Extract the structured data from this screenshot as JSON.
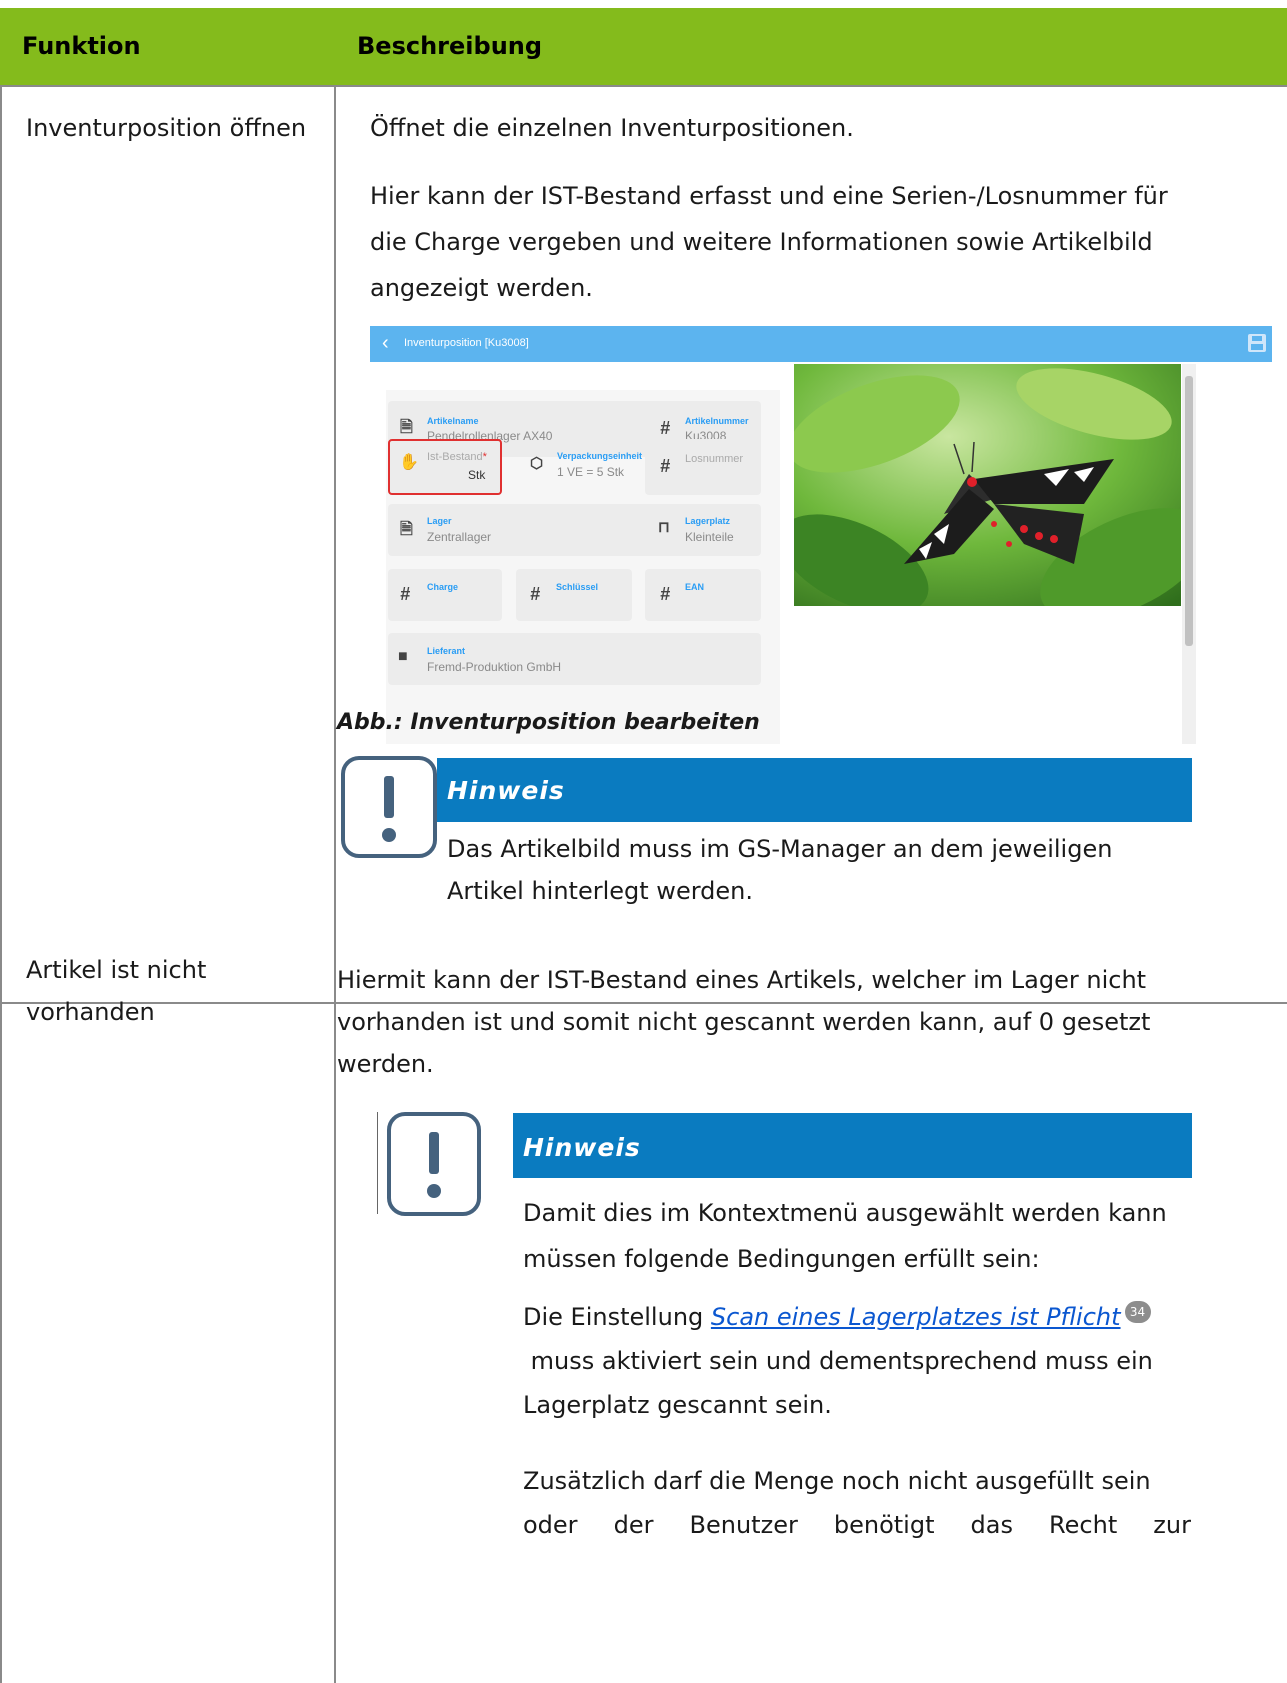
{
  "table": {
    "headers": {
      "funktion": "Funktion",
      "beschreibung": "Beschreibung"
    },
    "row1": {
      "funktion": "Inventurposition öffnen",
      "p1": "Öffnet die einzelnen Inventurpositionen.",
      "p2_line1": "Hier kann der IST-Bestand erfasst und eine Serien-/Losnummer für",
      "p2_line2": "die Charge vergeben und weitere Informationen sowie Artikelbild",
      "p2_line3": "angezeigt werden.",
      "caption": "Abb.: Inventurposition bearbeiten",
      "note_title": "Hinweis",
      "note_line1": "Das Artikelbild muss im GS-Manager an dem jeweiligen",
      "note_line2": "Artikel hinterlegt werden."
    },
    "row2": {
      "funktion_line1": "Artikel ist nicht",
      "funktion_line2": "vorhanden",
      "p1_line1": "Hiermit kann der IST-Bestand eines Artikels, welcher im Lager nicht",
      "p1_line2": "vorhanden ist und somit nicht gescannt werden kann, auf 0 gesetzt",
      "p1_line3": "werden.",
      "note_title": "Hinweis",
      "note_line1": "Damit dies im Kontextmenü ausgewählt werden kann",
      "note_line2": "müssen folgende Bedingungen erfüllt sein:",
      "setting_prefix": "Die Einstellung ",
      "setting_link": "Scan eines Lagerplatzes ist Pflicht",
      "setting_page": "34",
      "setting_line2": " muss aktiviert sein und dementsprechend muss ein",
      "setting_line3": "Lagerplatz gescannt sein.",
      "extra_line1": "Zusätzlich darf die Menge noch nicht ausgefüllt sein",
      "extra_line2_words": [
        "oder",
        "der",
        "Benutzer",
        "benötigt",
        "das",
        "Recht",
        "zur"
      ]
    }
  },
  "screenshot": {
    "title": "Inventurposition [Ku3008]",
    "fields": {
      "artikelname_label": "Artikelname",
      "artikelname_value": "Pendelrollenlager AX40",
      "artikelnummer_label": "Artikelnummer",
      "artikelnummer_value": "Ku3008",
      "istbestand_label": "Ist-Bestand",
      "istbestand_required": "*",
      "istbestand_unit": "Stk",
      "verpackung_label": "Verpackungseinheit",
      "verpackung_value": "1 VE = 5 Stk",
      "losnummer_label": "Losnummer",
      "lager_label": "Lager",
      "lager_value": "Zentrallager",
      "lagerplatz_label": "Lagerplatz",
      "lagerplatz_value": "Kleinteile",
      "charge_label": "Charge",
      "schluessel_label": "Schlüssel",
      "ean_label": "EAN",
      "lieferant_label": "Lieferant",
      "lieferant_value": "Fremd-Produktion GmbH"
    },
    "icons": {
      "back": "chevron-left-icon",
      "save": "save-icon",
      "hash": "hash-icon",
      "document": "document-icon",
      "hand": "hand-icon",
      "package": "package-icon",
      "warehouse": "warehouse-icon",
      "shelf": "shelf-icon",
      "truck": "truck-icon"
    },
    "colors": {
      "topbar": "#5cb4ef",
      "label": "#2a9df4",
      "required_border": "#e03030"
    }
  },
  "colors": {
    "header_bg": "#84bb1c",
    "note_bar": "#0a7bc0",
    "link": "#0b57d0"
  }
}
